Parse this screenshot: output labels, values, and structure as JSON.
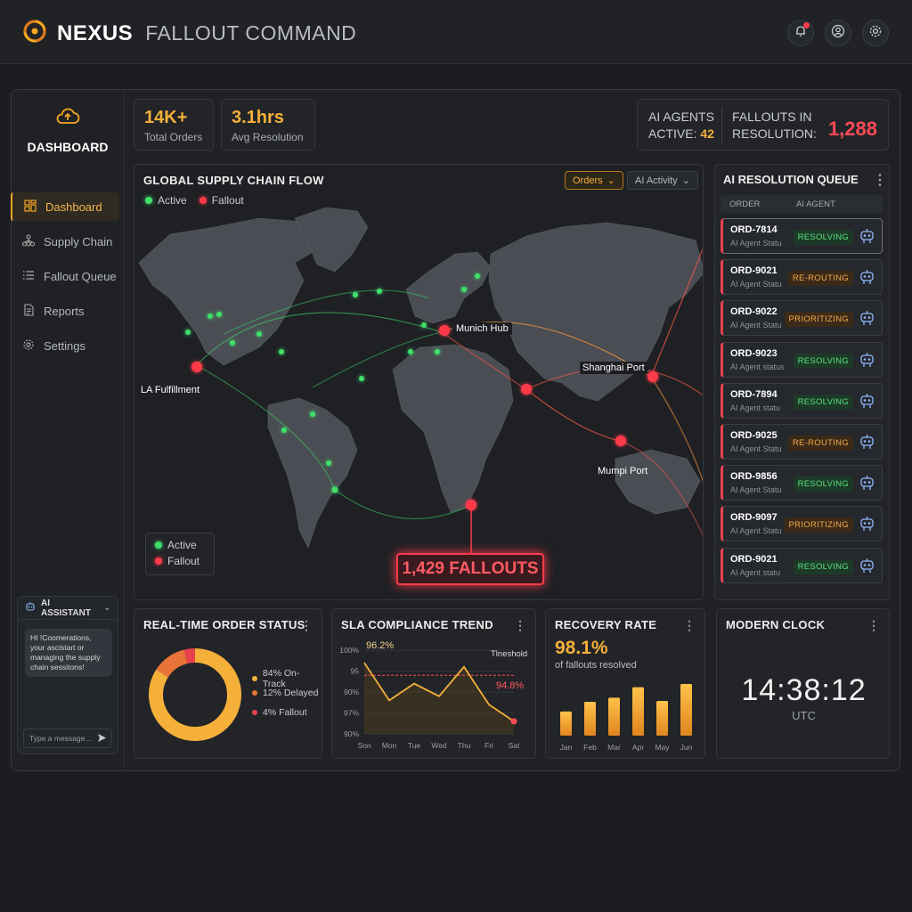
{
  "header": {
    "brand": "NEXUS",
    "subtitle": "FALLOUT COMMAND",
    "icons": [
      "bell-icon",
      "user-icon",
      "gear-icon"
    ]
  },
  "sidebar": {
    "title": "DASHBOARD",
    "items": [
      {
        "label": "Dashboard",
        "icon": "grid-icon",
        "active": true
      },
      {
        "label": "Supply Chain",
        "icon": "network-icon"
      },
      {
        "label": "Fallout Queue",
        "icon": "list-icon"
      },
      {
        "label": "Reports",
        "icon": "document-icon"
      },
      {
        "label": "Settings",
        "icon": "gear-icon"
      }
    ]
  },
  "assistant": {
    "title": "AI ASSISTANT",
    "message": "HI !Coomerations, your ascistart or managing the supply chain sessitons!",
    "placeholder": "Type a message..."
  },
  "kpis": {
    "orders_value": "14K+",
    "orders_label": "Total Orders",
    "resolution_value": "3.1hrs",
    "resolution_label": "Avg Resolution",
    "agents_label_1": "AI AGENTS",
    "agents_label_2": "ACTIVE:",
    "agents_value": "42",
    "fallouts_label_1": "FALLOUTS IN",
    "fallouts_label_2": "RESOLUTION:",
    "fallouts_value": "1,288"
  },
  "map": {
    "title": "GLOBAL SUPPLY CHAIN FLOW",
    "legend_active": "Active",
    "legend_fallout": "Fallout",
    "filter_orders": "Orders",
    "filter_ai": "AI Activity",
    "labels": {
      "munich": "Munich Hub",
      "la": "LA Fulfillment",
      "shanghai": "Shanghai Port",
      "mumbai": "Mumpi Port"
    },
    "fallouts_banner": "1,429 FALLOUTS"
  },
  "queue": {
    "title": "AI RESOLUTION QUEUE",
    "col_order": "ORDER",
    "col_agent": "AI AGENT",
    "items": [
      {
        "id": "ORD-7814",
        "sub": "AI Agent Statu",
        "status": "RESOLVING"
      },
      {
        "id": "ORD-9021",
        "sub": "AI Agent Statu",
        "status": "RE-ROUTING"
      },
      {
        "id": "ORD-9022",
        "sub": "AI Agent Statu",
        "status": "PRIORITIZING"
      },
      {
        "id": "ORD-9023",
        "sub": "AI Agent status",
        "status": "RESOLVING"
      },
      {
        "id": "ORD-7894",
        "sub": "AI Agent statu",
        "status": "RESOLVING"
      },
      {
        "id": "ORD-9025",
        "sub": "AI Agent Statu",
        "status": "RE-ROUTING"
      },
      {
        "id": "ORD-9856",
        "sub": "AI Agent Statu",
        "status": "RESOLVING"
      },
      {
        "id": "ORD-9097",
        "sub": "AI Agent Statu",
        "status": "PRIORITIZING"
      },
      {
        "id": "ORD-9021",
        "sub": "AI Agent statu",
        "status": "RESOLVING"
      }
    ]
  },
  "order_status": {
    "title": "REAL-TIME ORDER STATUS",
    "legend": [
      "84% On-Track",
      "12% Delayed",
      "4% Fallout"
    ],
    "colors": [
      "#f5b03a",
      "#e8743a",
      "#e8434f"
    ]
  },
  "sla": {
    "title": "SLA COMPLIANCE TREND",
    "start_label": "96.2%",
    "end_label": "94.8%",
    "threshold_label": "Tlneshold"
  },
  "recovery": {
    "title": "RECOVERY RATE",
    "value": "98.1%",
    "caption": "of fallouts resolved"
  },
  "clock": {
    "title": "MODERN CLOCK",
    "time": "14:38:12",
    "zone": "UTC"
  },
  "chart_data": [
    {
      "type": "pie",
      "title": "REAL-TIME ORDER STATUS",
      "categories": [
        "On-Track",
        "Delayed",
        "Fallout"
      ],
      "values": [
        84,
        12,
        4
      ]
    },
    {
      "type": "line",
      "title": "SLA COMPLIANCE TREND",
      "x": [
        "Son",
        "Mon",
        "Tue",
        "Wed",
        "Thu",
        "Fri",
        "Sat"
      ],
      "values": [
        96.2,
        95.3,
        95.7,
        95.4,
        96.1,
        95.2,
        94.8
      ],
      "threshold": 95.9,
      "yticks": [
        "100%",
        "95",
        "90%",
        "97%",
        "90%"
      ]
    },
    {
      "type": "bar",
      "title": "RECOVERY RATE",
      "categories": [
        "Jan",
        "Feb",
        "Mar",
        "Apr",
        "May",
        "Jun"
      ],
      "values": [
        30,
        42,
        47,
        60,
        43,
        64
      ]
    }
  ]
}
